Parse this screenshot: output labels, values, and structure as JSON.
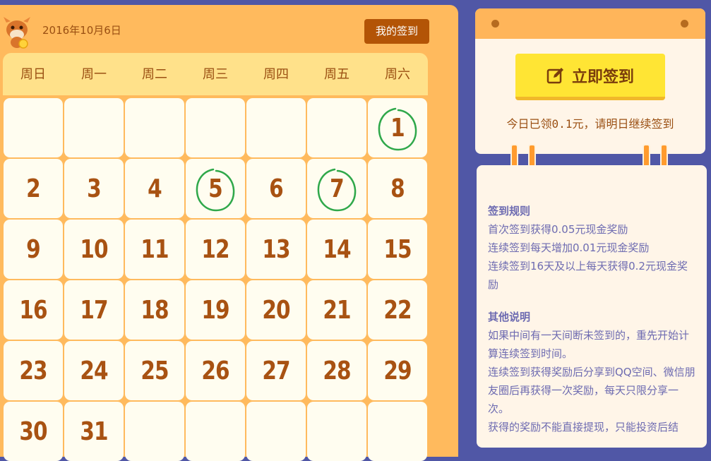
{
  "header": {
    "date": "2016年10月6日",
    "my_sign_button": "我的签到"
  },
  "week_days": [
    "周日",
    "周一",
    "周二",
    "周三",
    "周四",
    "周五",
    "周六"
  ],
  "calendar": {
    "leading_blanks": 6,
    "days": [
      "1",
      "2",
      "3",
      "4",
      "5",
      "6",
      "7",
      "8",
      "9",
      "10",
      "11",
      "12",
      "13",
      "14",
      "15",
      "16",
      "17",
      "18",
      "19",
      "20",
      "21",
      "22",
      "23",
      "24",
      "25",
      "26",
      "27",
      "28",
      "29",
      "30",
      "31"
    ],
    "signed_days": [
      "1",
      "5",
      "7"
    ],
    "trailing_blanks": 5
  },
  "sign_card": {
    "button_label": "立即签到",
    "today_note": "今日已领0.1元，请明日继续签到"
  },
  "rules": {
    "title1": "签到规则",
    "lines1": [
      "首次签到获得0.05元现金奖励",
      "连续签到每天增加0.01元现金奖励",
      "连续签到16天及以上每天获得0.2元现金奖励"
    ],
    "title2": "其他说明",
    "lines2": [
      "如果中间有一天间断未签到的，重先开始计算连续签到时间。",
      "连续签到获得奖励后分享到QQ空间、微信朋友圈后再获得一次奖励，每天只限分享一次。",
      "获得的奖励不能直接提现，只能投资后结"
    ]
  },
  "colors": {
    "background": "#5057a6",
    "panel": "#ffba5d",
    "cell": "#fffdf0",
    "day_number": "#a85212",
    "signed_ring": "#2fa84a",
    "sign_button": "#ffe534"
  }
}
